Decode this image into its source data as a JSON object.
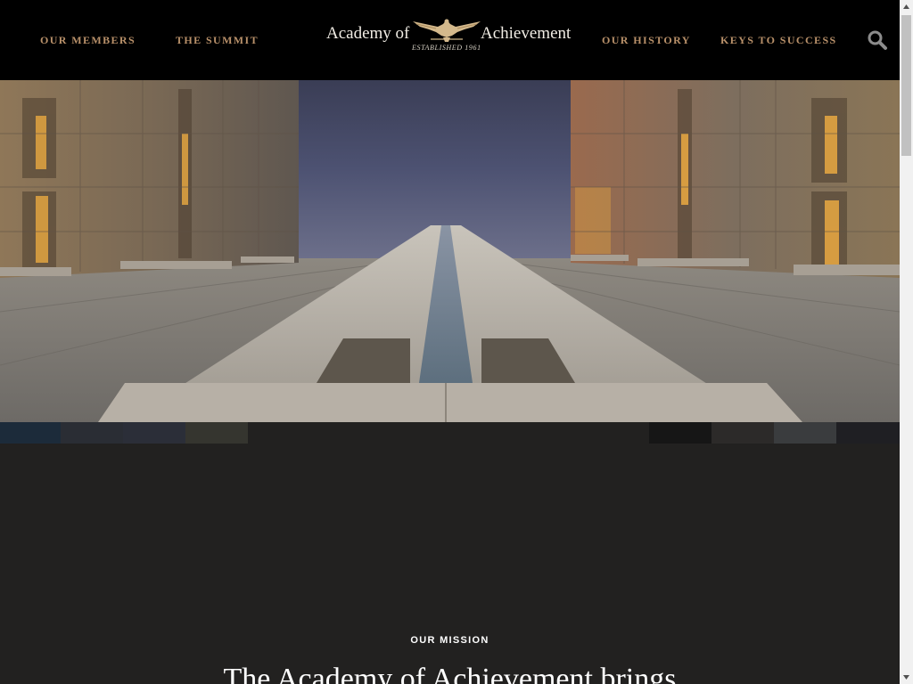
{
  "nav": {
    "left": [
      {
        "label": "OUR MEMBERS"
      },
      {
        "label": "THE SUMMIT"
      }
    ],
    "right": [
      {
        "label": "OUR HISTORY"
      },
      {
        "label": "KEYS TO SUCCESS"
      }
    ],
    "search_icon": "search-icon"
  },
  "logo": {
    "left_text": "Academy of",
    "right_text": "Achievement",
    "subtitle": "ESTABLISHED 1961",
    "emblem": "eagle-icon"
  },
  "hero": {
    "image": "salk-institute-courtyard-photo"
  },
  "mission": {
    "label": "OUR MISSION",
    "heading": "The Academy of Achievement brings"
  },
  "colors": {
    "nav_text": "#b9916a",
    "header_bg": "#000000",
    "page_bg": "#222120"
  }
}
